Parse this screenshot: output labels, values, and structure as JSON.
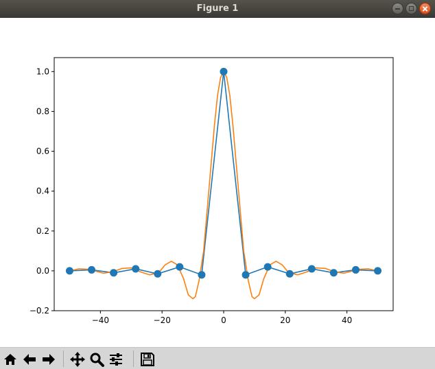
{
  "window": {
    "title": "Figure 1"
  },
  "toolbar": {
    "buttons": [
      {
        "name": "home-icon"
      },
      {
        "name": "back-arrow-icon"
      },
      {
        "name": "forward-arrow-icon"
      },
      {
        "name": "pan-icon"
      },
      {
        "name": "zoom-icon"
      },
      {
        "name": "configure-subplots-icon"
      },
      {
        "name": "save-icon"
      }
    ]
  },
  "chart_data": {
    "type": "line",
    "title": "",
    "xlabel": "",
    "ylabel": "",
    "xlim": [
      -55.0,
      55.0
    ],
    "ylim": [
      -0.2,
      1.07
    ],
    "xticks": [
      -40,
      -20,
      0,
      20,
      40
    ],
    "xtick_labels": [
      "−40",
      "−20",
      "0",
      "20",
      "40"
    ],
    "yticks": [
      -0.2,
      0.0,
      0.2,
      0.4,
      0.6,
      0.8,
      1.0
    ],
    "ytick_labels": [
      "−0.2",
      "0.0",
      "0.2",
      "0.4",
      "0.6",
      "0.8",
      "1.0"
    ],
    "grid": false,
    "colors": {
      "series1": "#1f77b4",
      "series2": "#ff7f0e"
    },
    "series": [
      {
        "markers": true,
        "x": [
          -50,
          -42.86,
          -35.71,
          -28.57,
          -21.43,
          -14.29,
          -7.14,
          0,
          7.14,
          14.29,
          21.43,
          28.57,
          35.71,
          42.86,
          50
        ],
        "y": [
          0.0,
          0.005,
          -0.01,
          0.01,
          -0.015,
          0.02,
          -0.02,
          1.0,
          -0.02,
          0.02,
          -0.015,
          0.01,
          -0.01,
          0.005,
          0.0
        ]
      },
      {
        "markers": false,
        "x": [
          -50,
          -47,
          -44,
          -42,
          -39,
          -36,
          -33,
          -30,
          -27,
          -24,
          -21,
          -19,
          -17,
          -15,
          -13,
          -11.5,
          -10,
          -9.2,
          -8,
          -6.5,
          -5,
          -4,
          -3,
          -2,
          -1,
          0,
          1,
          2,
          3,
          4,
          5,
          6.5,
          8,
          9.2,
          10,
          11.5,
          13,
          15,
          17,
          19,
          21,
          24,
          27,
          30,
          33,
          36,
          39,
          42,
          44,
          47,
          50
        ],
        "y": [
          0.0,
          0.01,
          0.008,
          0.0,
          -0.012,
          -0.005,
          0.012,
          0.015,
          -0.005,
          -0.02,
          -0.008,
          0.03,
          0.048,
          0.03,
          -0.04,
          -0.12,
          -0.14,
          -0.13,
          -0.05,
          0.1,
          0.37,
          0.55,
          0.73,
          0.88,
          0.97,
          1.0,
          0.97,
          0.88,
          0.73,
          0.55,
          0.37,
          0.1,
          -0.05,
          -0.13,
          -0.14,
          -0.12,
          -0.04,
          0.03,
          0.048,
          0.03,
          -0.008,
          -0.02,
          -0.005,
          0.015,
          0.012,
          -0.005,
          -0.012,
          0.0,
          0.008,
          0.01,
          0.0
        ]
      }
    ]
  }
}
